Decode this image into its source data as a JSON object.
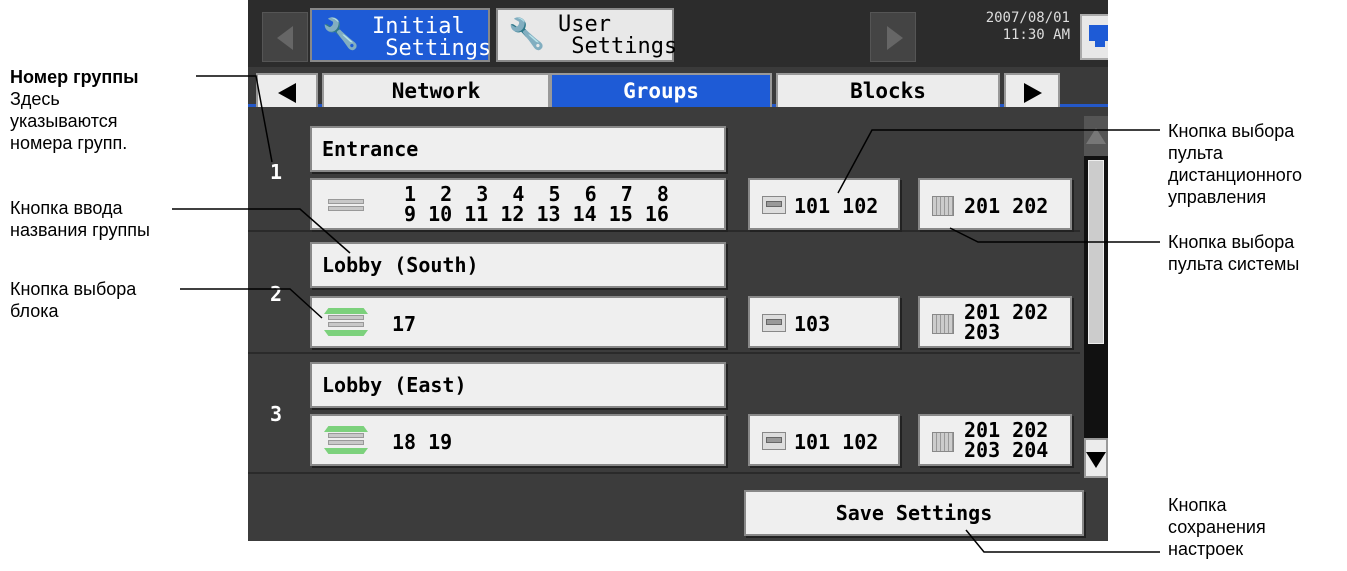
{
  "header": {
    "tab_initial": "Initial\n Settings",
    "tab_user": "User\n Settings",
    "date": "2007/08/01",
    "time": "11:30 AM"
  },
  "subtabs": {
    "network": "Network",
    "groups": "Groups",
    "blocks": "Blocks"
  },
  "groups": [
    {
      "number": "1",
      "name": "Entrance",
      "units": " 1  2  3  4  5  6  7  8\n 9 10 11 12 13 14 15 16",
      "remote": "101 102",
      "system": "201 202"
    },
    {
      "number": "2",
      "name": "Lobby (South)",
      "units": "17",
      "remote": "103",
      "system": "201 202\n203"
    },
    {
      "number": "3",
      "name": "Lobby (East)",
      "units": "18 19",
      "remote": "101 102",
      "system": "201 202\n203 204"
    }
  ],
  "save_label": "Save Settings",
  "annotations": {
    "group_number_title": "Номер группы",
    "group_number_desc": "Здесь\nуказываются\nномера групп.",
    "name_button": "Кнопка ввода\nназвания группы",
    "unit_button": "Кнопка выбора\nблока",
    "remote_button": "Кнопка выбора\nпульта\nдистанционного\nуправления",
    "system_button": "Кнопка выбора\nпульта системы",
    "save_button": "Кнопка\nсохранения\nнастроек"
  }
}
